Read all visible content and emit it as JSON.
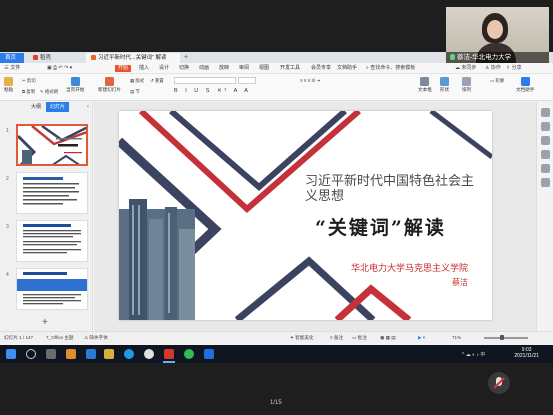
{
  "meeting": {
    "participant_name": "蔡洁-华北电力大学",
    "page_counter": "1/15"
  },
  "app": {
    "tabs": {
      "home": "首页",
      "shell": "稻壳",
      "document": "习近平新时代...关键词” 解读"
    },
    "menus": [
      "三 文件",
      "开始",
      "插入",
      "设计",
      "切换",
      "动画",
      "放映",
      "审阅",
      "视图",
      "开发工具",
      "会员专享",
      "文档助手"
    ],
    "menu_active": "开始",
    "menu_right": {
      "search": "查找命令、搜索模板",
      "sync": "未同步",
      "collab": "协作",
      "share": "分享"
    },
    "ribbon": {
      "paste": "粘贴",
      "cut": "剪切",
      "copy": "复制",
      "format_painter": "格式刷",
      "from_current": "当页开始",
      "new_slide": "新建幻灯片",
      "layout": "版式",
      "section": "节",
      "reset": "重置",
      "text_box": "文本框",
      "shape": "形状",
      "arrange": "排列",
      "outline": "轮廓",
      "doc_assistant": "文档助手"
    },
    "left_panel": {
      "tab_outline": "大纲",
      "tab_slides": "幻灯片",
      "slide_numbers": [
        "1",
        "2",
        "3",
        "4"
      ]
    },
    "slide": {
      "title": "习近平新时代中国特色社会主义思想",
      "keyword": "“关键词”解读",
      "organization": "华北电力大学马克思主义学院",
      "author": "蔡洁"
    },
    "status": {
      "slide_count": "幻灯片 1 / 147",
      "theme": "7_Office 主题",
      "missing_font": "缺失字体",
      "smart_beautify": "智能美化",
      "notes": "备注",
      "comments": "批注",
      "zoom": "71%"
    },
    "taskbar": {
      "time": "9:03",
      "date": "2021/11/21"
    }
  }
}
